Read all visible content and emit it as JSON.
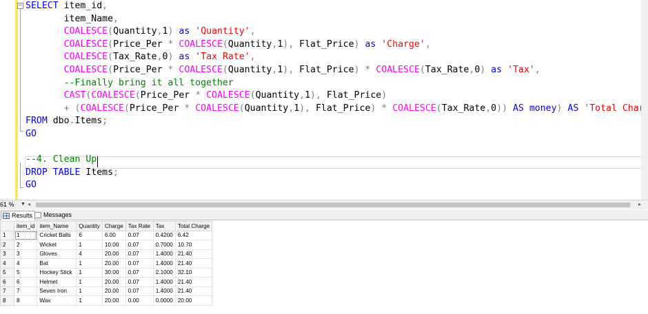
{
  "editor": {
    "collapse_symbol": "−",
    "lines": [
      [
        {
          "t": "SELECT",
          "c": "kw"
        },
        {
          "t": " item_id",
          "c": "tx"
        },
        {
          "t": ",",
          "c": "op"
        }
      ],
      [
        {
          "t": "       item_Name",
          "c": "tx"
        },
        {
          "t": ",",
          "c": "op"
        }
      ],
      [
        {
          "t": "       ",
          "c": "tx"
        },
        {
          "t": "COALESCE",
          "c": "fn"
        },
        {
          "t": "(",
          "c": "op"
        },
        {
          "t": "Quantity",
          "c": "tx"
        },
        {
          "t": ",",
          "c": "op"
        },
        {
          "t": "1",
          "c": "tx"
        },
        {
          "t": ")",
          "c": "op"
        },
        {
          "t": " ",
          "c": "tx"
        },
        {
          "t": "as",
          "c": "kw"
        },
        {
          "t": " ",
          "c": "tx"
        },
        {
          "t": "'Quantity'",
          "c": "str"
        },
        {
          "t": ",",
          "c": "op"
        }
      ],
      [
        {
          "t": "       ",
          "c": "tx"
        },
        {
          "t": "COALESCE",
          "c": "fn"
        },
        {
          "t": "(",
          "c": "op"
        },
        {
          "t": "Price_Per ",
          "c": "tx"
        },
        {
          "t": "*",
          "c": "op"
        },
        {
          "t": " ",
          "c": "tx"
        },
        {
          "t": "COALESCE",
          "c": "fn"
        },
        {
          "t": "(",
          "c": "op"
        },
        {
          "t": "Quantity",
          "c": "tx"
        },
        {
          "t": ",",
          "c": "op"
        },
        {
          "t": "1",
          "c": "tx"
        },
        {
          "t": "),",
          "c": "op"
        },
        {
          "t": " Flat_Price",
          "c": "tx"
        },
        {
          "t": ")",
          "c": "op"
        },
        {
          "t": " ",
          "c": "tx"
        },
        {
          "t": "as",
          "c": "kw"
        },
        {
          "t": " ",
          "c": "tx"
        },
        {
          "t": "'Charge'",
          "c": "str"
        },
        {
          "t": ",",
          "c": "op"
        }
      ],
      [
        {
          "t": "       ",
          "c": "tx"
        },
        {
          "t": "COALESCE",
          "c": "fn"
        },
        {
          "t": "(",
          "c": "op"
        },
        {
          "t": "Tax_Rate",
          "c": "tx"
        },
        {
          "t": ",",
          "c": "op"
        },
        {
          "t": "0",
          "c": "tx"
        },
        {
          "t": ")",
          "c": "op"
        },
        {
          "t": " ",
          "c": "tx"
        },
        {
          "t": "as",
          "c": "kw"
        },
        {
          "t": " ",
          "c": "tx"
        },
        {
          "t": "'Tax Rate'",
          "c": "str"
        },
        {
          "t": ",",
          "c": "op"
        }
      ],
      [
        {
          "t": "       ",
          "c": "tx"
        },
        {
          "t": "COALESCE",
          "c": "fn"
        },
        {
          "t": "(",
          "c": "op"
        },
        {
          "t": "Price_Per ",
          "c": "tx"
        },
        {
          "t": "*",
          "c": "op"
        },
        {
          "t": " ",
          "c": "tx"
        },
        {
          "t": "COALESCE",
          "c": "fn"
        },
        {
          "t": "(",
          "c": "op"
        },
        {
          "t": "Quantity",
          "c": "tx"
        },
        {
          "t": ",",
          "c": "op"
        },
        {
          "t": "1",
          "c": "tx"
        },
        {
          "t": "),",
          "c": "op"
        },
        {
          "t": " Flat_Price",
          "c": "tx"
        },
        {
          "t": ")",
          "c": "op"
        },
        {
          "t": " ",
          "c": "tx"
        },
        {
          "t": "*",
          "c": "op"
        },
        {
          "t": " ",
          "c": "tx"
        },
        {
          "t": "COALESCE",
          "c": "fn"
        },
        {
          "t": "(",
          "c": "op"
        },
        {
          "t": "Tax_Rate",
          "c": "tx"
        },
        {
          "t": ",",
          "c": "op"
        },
        {
          "t": "0",
          "c": "tx"
        },
        {
          "t": ")",
          "c": "op"
        },
        {
          "t": " ",
          "c": "tx"
        },
        {
          "t": "as",
          "c": "kw"
        },
        {
          "t": " ",
          "c": "tx"
        },
        {
          "t": "'Tax'",
          "c": "str"
        },
        {
          "t": ",",
          "c": "op"
        }
      ],
      [
        {
          "t": "       --Finally bring it all together",
          "c": "cm"
        }
      ],
      [
        {
          "t": "       ",
          "c": "tx"
        },
        {
          "t": "CAST",
          "c": "fn"
        },
        {
          "t": "(",
          "c": "op"
        },
        {
          "t": "COALESCE",
          "c": "fn"
        },
        {
          "t": "(",
          "c": "op"
        },
        {
          "t": "Price_Per ",
          "c": "tx"
        },
        {
          "t": "*",
          "c": "op"
        },
        {
          "t": " ",
          "c": "tx"
        },
        {
          "t": "COALESCE",
          "c": "fn"
        },
        {
          "t": "(",
          "c": "op"
        },
        {
          "t": "Quantity",
          "c": "tx"
        },
        {
          "t": ",",
          "c": "op"
        },
        {
          "t": "1",
          "c": "tx"
        },
        {
          "t": "),",
          "c": "op"
        },
        {
          "t": " Flat_Price",
          "c": "tx"
        },
        {
          "t": ")",
          "c": "op"
        }
      ],
      [
        {
          "t": "       ",
          "c": "tx"
        },
        {
          "t": "+",
          "c": "op"
        },
        {
          "t": " ",
          "c": "tx"
        },
        {
          "t": "(",
          "c": "op"
        },
        {
          "t": "COALESCE",
          "c": "fn"
        },
        {
          "t": "(",
          "c": "op"
        },
        {
          "t": "Price_Per ",
          "c": "tx"
        },
        {
          "t": "*",
          "c": "op"
        },
        {
          "t": " ",
          "c": "tx"
        },
        {
          "t": "COALESCE",
          "c": "fn"
        },
        {
          "t": "(",
          "c": "op"
        },
        {
          "t": "Quantity",
          "c": "tx"
        },
        {
          "t": ",",
          "c": "op"
        },
        {
          "t": "1",
          "c": "tx"
        },
        {
          "t": "),",
          "c": "op"
        },
        {
          "t": " Flat_Price",
          "c": "tx"
        },
        {
          "t": ")",
          "c": "op"
        },
        {
          "t": " ",
          "c": "tx"
        },
        {
          "t": "*",
          "c": "op"
        },
        {
          "t": " ",
          "c": "tx"
        },
        {
          "t": "COALESCE",
          "c": "fn"
        },
        {
          "t": "(",
          "c": "op"
        },
        {
          "t": "Tax_Rate",
          "c": "tx"
        },
        {
          "t": ",",
          "c": "op"
        },
        {
          "t": "0",
          "c": "tx"
        },
        {
          "t": "))",
          "c": "op"
        },
        {
          "t": " ",
          "c": "tx"
        },
        {
          "t": "AS",
          "c": "kw"
        },
        {
          "t": " ",
          "c": "tx"
        },
        {
          "t": "money",
          "c": "kw"
        },
        {
          "t": ")",
          "c": "op"
        },
        {
          "t": " ",
          "c": "tx"
        },
        {
          "t": "AS",
          "c": "kw"
        },
        {
          "t": " ",
          "c": "tx"
        },
        {
          "t": "'Total Charge",
          "c": "str"
        }
      ],
      [
        {
          "t": "FROM",
          "c": "kw"
        },
        {
          "t": " dbo",
          "c": "tx"
        },
        {
          "t": ".",
          "c": "op"
        },
        {
          "t": "Items",
          "c": "tx"
        },
        {
          "t": ";",
          "c": "op"
        }
      ],
      [
        {
          "t": "GO",
          "c": "kw"
        }
      ],
      [],
      [
        {
          "t": "--4. Clean Up",
          "c": "cm"
        }
      ],
      [
        {
          "t": "DROP",
          "c": "kw"
        },
        {
          "t": " ",
          "c": "tx"
        },
        {
          "t": "TABLE",
          "c": "kw"
        },
        {
          "t": " Items",
          "c": "tx"
        },
        {
          "t": ";",
          "c": "op"
        }
      ],
      [
        {
          "t": "GO",
          "c": "kw"
        }
      ]
    ]
  },
  "statusbar": {
    "zoom": "61 %",
    "zoom_arrow": "▼",
    "scroll_left": "◂",
    "scroll_right": "▸"
  },
  "results_tabs": [
    {
      "label": "Results",
      "icon": "grid-icon",
      "active": true
    },
    {
      "label": "Messages",
      "icon": "messages-icon",
      "active": false
    }
  ],
  "results": {
    "columns": [
      "item_id",
      "item_Name",
      "Quantity",
      "Charge",
      "Tax Rate",
      "Tax",
      "Total Charge"
    ],
    "rows": [
      [
        "1",
        "1",
        "Cricket Balls",
        "6",
        "6.00",
        "0.07",
        "0.4200",
        "6.42"
      ],
      [
        "2",
        "2",
        "Wicket",
        "1",
        "10.00",
        "0.07",
        "0.7000",
        "10.70"
      ],
      [
        "3",
        "3",
        "Gloves",
        "4",
        "20.00",
        "0.07",
        "1.4000",
        "21.40"
      ],
      [
        "4",
        "4",
        "Bat",
        "1",
        "20.00",
        "0.07",
        "1.4000",
        "21.40"
      ],
      [
        "5",
        "5",
        "Hockey Stick",
        "1",
        "30.00",
        "0.07",
        "2.1000",
        "32.10"
      ],
      [
        "6",
        "6",
        "Helmet",
        "1",
        "20.00",
        "0.07",
        "1.4000",
        "21.40"
      ],
      [
        "7",
        "7",
        "Seven Iron",
        "1",
        "20.00",
        "0.07",
        "1.4000",
        "21.40"
      ],
      [
        "8",
        "8",
        "Wax",
        "1",
        "20.00",
        "0.00",
        "0.0000",
        "20.00"
      ]
    ]
  }
}
